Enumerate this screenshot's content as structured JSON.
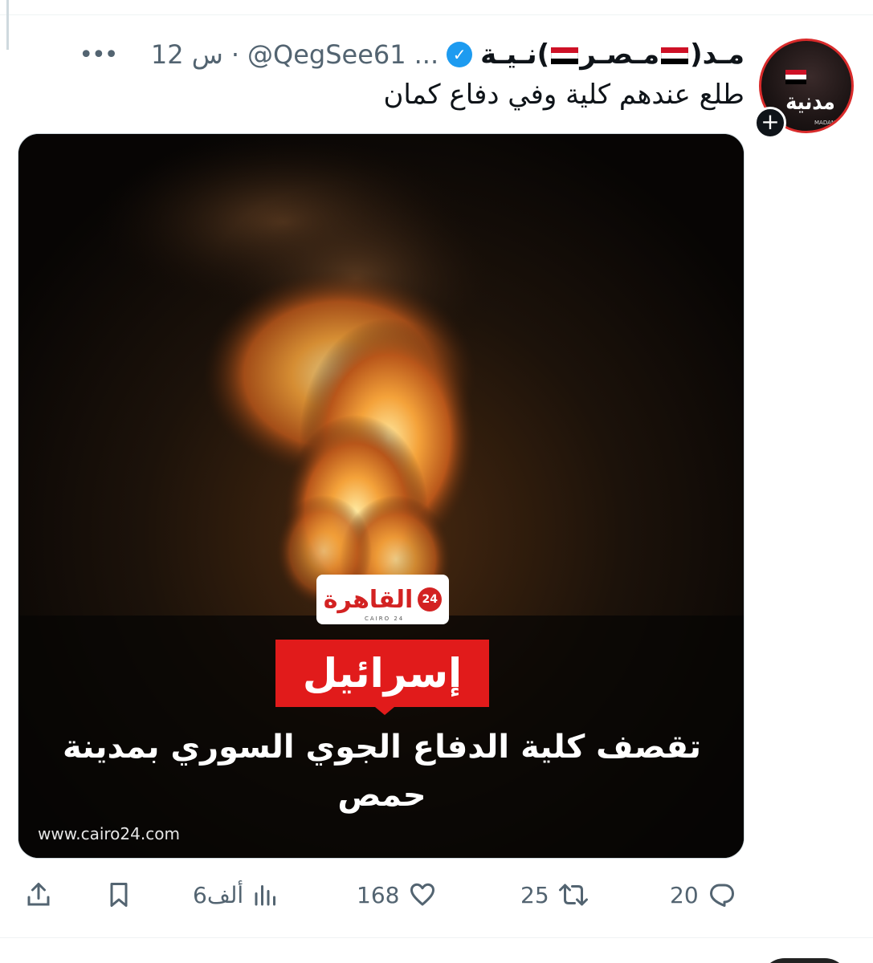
{
  "post": {
    "display_name": "مـد( مـصـر )نـيـة",
    "display_name_prefix": "مـد(",
    "display_name_middle": "مـصـر",
    "display_name_suffix": ")نـيـة",
    "truncation": "...",
    "handle": "@QegSee61",
    "separator": "·",
    "time": "12 س",
    "more_label": "•••",
    "text": "طلع عندهم كلية وفي دفاع كمان",
    "follow_symbol": "+",
    "verified_symbol": "✓"
  },
  "avatar": {
    "logo_text": "مدنية",
    "sub_text": "MADANEYA"
  },
  "media": {
    "logo_text": "القاهرة",
    "logo_badge": "24",
    "logo_sub": "CAIRO 24",
    "headline_red": "إسرائيل",
    "headline_white": "تقصف كلية الدفاع الجوي السوري بمدينة حمص",
    "source_url": "www.cairo24.com"
  },
  "actions": {
    "reply_count": "20",
    "retweet_count": "25",
    "like_count": "168",
    "views_count": "6ألف"
  },
  "icons": [
    "share-icon",
    "bookmark-icon",
    "views-icon",
    "like-icon",
    "retweet-icon",
    "reply-icon",
    "verified-icon",
    "more-icon",
    "flag-egypt-icon"
  ],
  "colors": {
    "verified": "#1d9bf0",
    "secondary_text": "#536471",
    "headline_red": "#e11b1b"
  }
}
